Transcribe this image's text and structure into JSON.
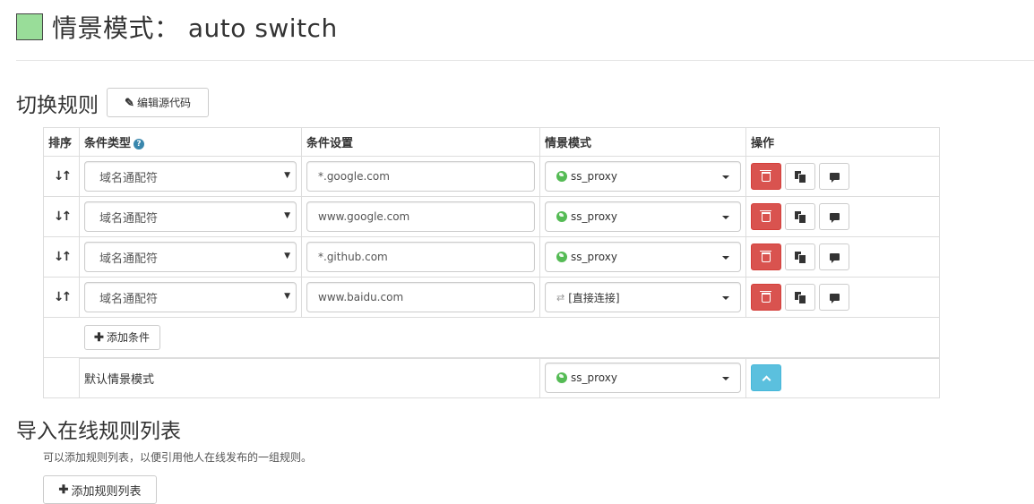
{
  "header": {
    "swatch_color": "#99dd99",
    "title": "情景模式： auto switch"
  },
  "switch_rules": {
    "section_title": "切换规则",
    "edit_source_label": "编辑源代码",
    "edit_source_icon": "edit-icon",
    "columns": {
      "sort": "排序",
      "condition_type": "条件类型",
      "condition_setting": "条件设置",
      "profile": "情景模式",
      "actions": "操作"
    },
    "rows": [
      {
        "type": "域名通配符",
        "setting": "*.google.com",
        "profile": "ss_proxy",
        "profile_icon": "globe-icon",
        "profile_color": "#55bb55"
      },
      {
        "type": "域名通配符",
        "setting": "www.google.com",
        "profile": "ss_proxy",
        "profile_icon": "globe-icon",
        "profile_color": "#55bb55"
      },
      {
        "type": "域名通配符",
        "setting": "*.github.com",
        "profile": "ss_proxy",
        "profile_icon": "globe-icon",
        "profile_color": "#55bb55"
      },
      {
        "type": "域名通配符",
        "setting": "www.baidu.com",
        "profile": "[直接连接]",
        "profile_icon": "transfer-icon",
        "profile_color": "#999999"
      }
    ],
    "add_condition_label": "添加条件",
    "default_row": {
      "label": "默认情景模式",
      "profile": "ss_proxy"
    },
    "colors": {
      "danger": "#d9534f",
      "info": "#5bc0de"
    }
  },
  "import_rules": {
    "section_title": "导入在线规则列表",
    "description": "可以添加规则列表，以便引用他人在线发布的一组规则。",
    "add_list_label": "添加规则列表"
  }
}
